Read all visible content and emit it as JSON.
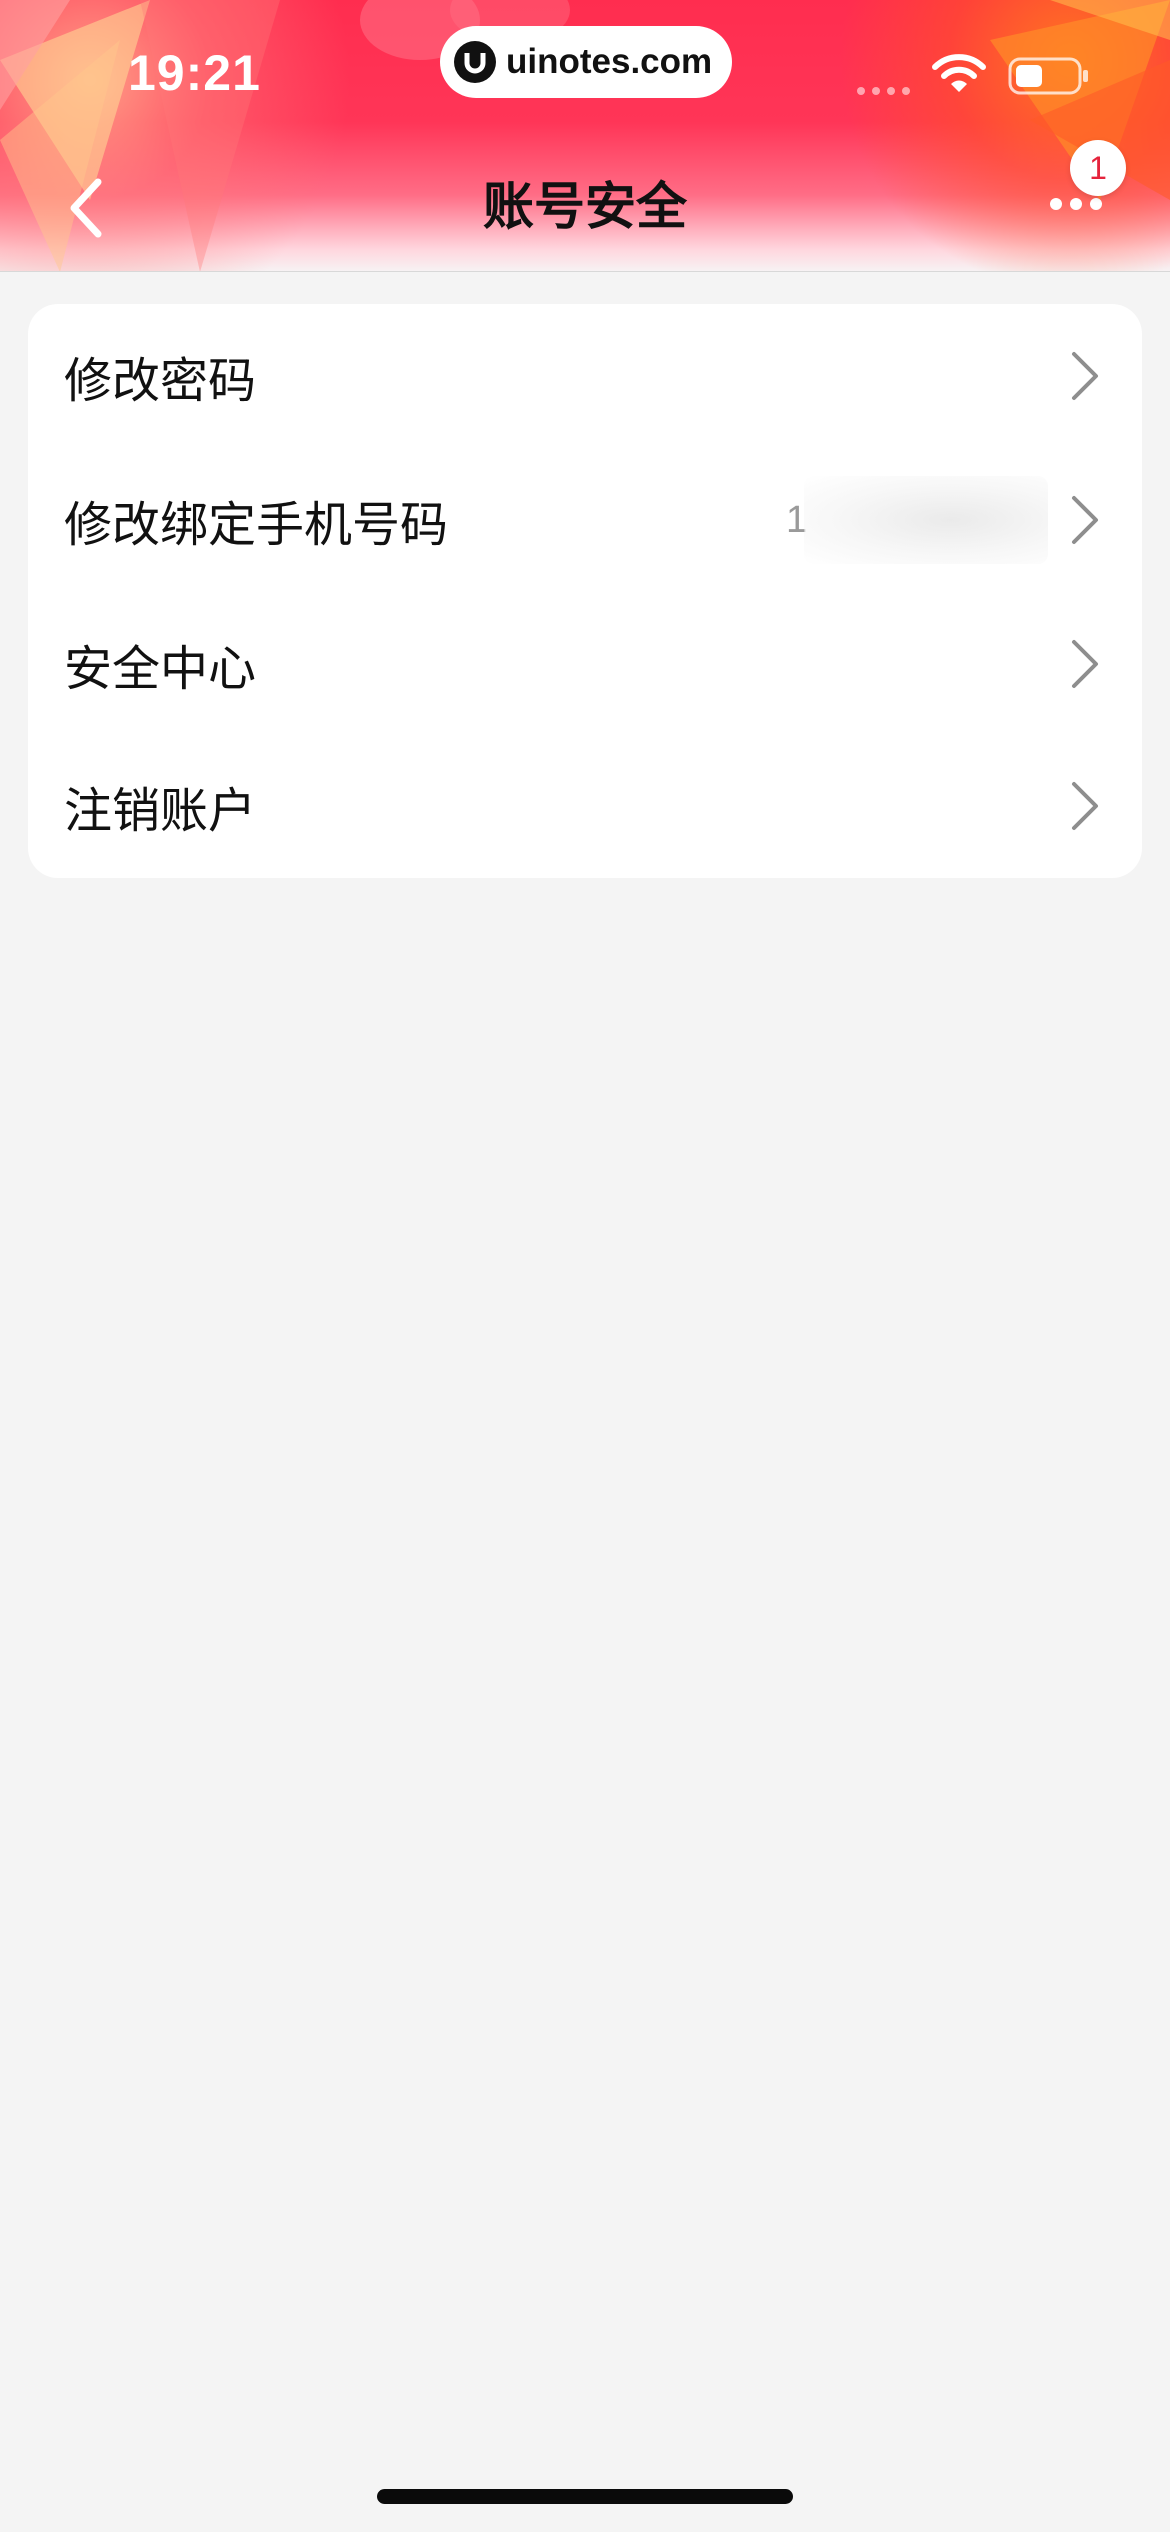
{
  "status_bar": {
    "time": "19:21",
    "url": "uinotes.com"
  },
  "nav": {
    "title": "账号安全",
    "notification_count": "1"
  },
  "settings": {
    "items": [
      {
        "label": "修改密码",
        "value": ""
      },
      {
        "label": "修改绑定手机号码",
        "value": "1"
      },
      {
        "label": "安全中心",
        "value": ""
      },
      {
        "label": "注销账户",
        "value": ""
      }
    ]
  },
  "colors": {
    "header_red": "#ff2d4f",
    "accent_orange": "#ff7a1e",
    "background": "#f4f4f4",
    "card": "#ffffff",
    "text_primary": "#111111",
    "text_secondary": "#9a9a9a",
    "badge_text": "#e5233c"
  },
  "icons": [
    "back-chevron-icon",
    "more-dots-icon",
    "wifi-icon",
    "battery-icon",
    "signal-icon",
    "chevron-right-icon"
  ]
}
